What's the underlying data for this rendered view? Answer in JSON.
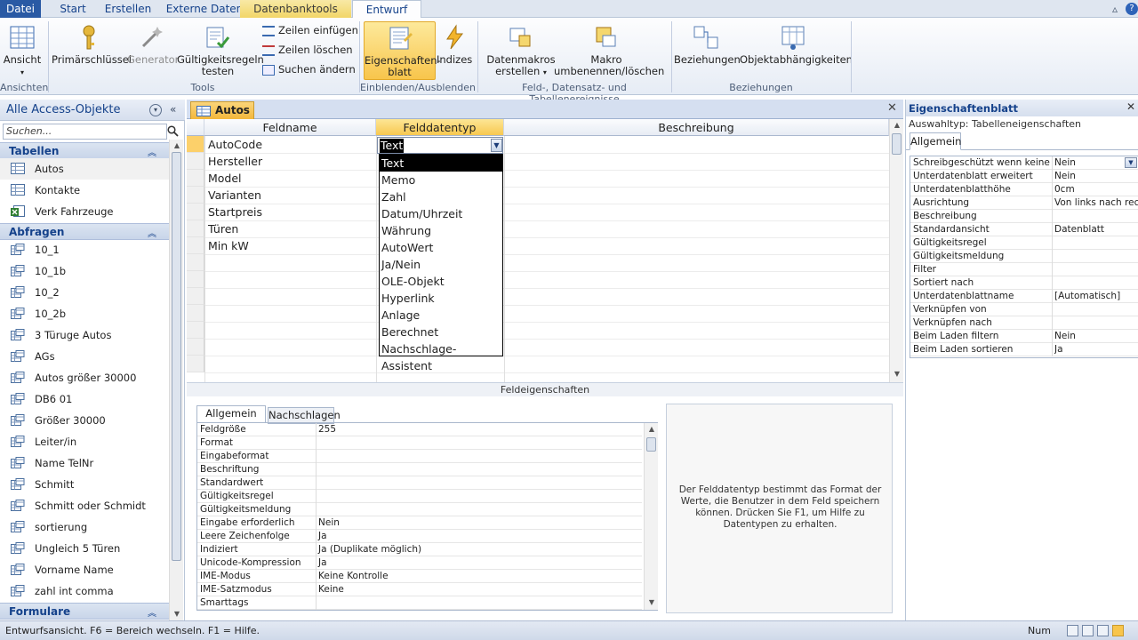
{
  "ribbon_tabs": [
    "Datei",
    "Start",
    "Erstellen",
    "Externe Daten",
    "Datenbanktools",
    "Entwurf"
  ],
  "ribbon": {
    "ansicht": "Ansicht",
    "primaerschluessel": "Primärschlüssel",
    "generator": "Generator",
    "gueltigkeitsregeln": "Gültigkeitsregeln testen",
    "zeilen_einfuegen": "Zeilen einfügen",
    "zeilen_loeschen": "Zeilen löschen",
    "suchen_aendern": "Suchen ändern",
    "eigenschaftenblatt": "Eigenschaften-blatt",
    "indizes": "Indizes",
    "datenmakros": "Datenmakros erstellen",
    "makro": "Makro umbenennen/löschen",
    "beziehungen": "Beziehungen",
    "objektabhaengigkeiten": "Objektabhängigkeiten",
    "groups": {
      "ansichten": "Ansichten",
      "tools": "Tools",
      "einblenden": "Einblenden/Ausblenden",
      "ereignisse": "Feld-, Datensatz- und Tabellenereignisse",
      "beziehungen": "Beziehungen"
    }
  },
  "nav": {
    "title": "Alle Access-Objekte",
    "search_placeholder": "Suchen...",
    "sections": {
      "tabellen": "Tabellen",
      "abfragen": "Abfragen",
      "formulare": "Formulare"
    },
    "tabellen": [
      "Autos",
      "Kontakte",
      "Verk Fahrzeuge"
    ],
    "abfragen": [
      "10_1",
      "10_1b",
      "10_2",
      "10_2b",
      "3 Türuge Autos",
      "AGs",
      "Autos größer 30000",
      "DB6 01",
      "Größer 30000",
      "Leiter/in",
      "Name TelNr",
      "Schmitt",
      "Schmitt oder Schmidt",
      "sortierung",
      "Ungleich 5 Türen",
      "Vorname Name",
      "zahl int comma"
    ]
  },
  "doc": {
    "tab_title": "Autos",
    "columns": [
      "Feldname",
      "Felddatentyp",
      "Beschreibung"
    ],
    "fields": [
      "AutoCode",
      "Hersteller",
      "Model",
      "Varianten",
      "Startpreis",
      "Türen",
      "Min kW"
    ],
    "current_type": "Text",
    "dropdown_options": [
      "Text",
      "Memo",
      "Zahl",
      "Datum/Uhrzeit",
      "Währung",
      "AutoWert",
      "Ja/Nein",
      "OLE-Objekt",
      "Hyperlink",
      "Anlage",
      "Berechnet",
      "Nachschlage-Assistent"
    ],
    "feldeigenschaften": "Feldeigenschaften",
    "prop_tabs": [
      "Allgemein",
      "Nachschlagen"
    ],
    "properties": [
      {
        "k": "Feldgröße",
        "v": "255"
      },
      {
        "k": "Format",
        "v": ""
      },
      {
        "k": "Eingabeformat",
        "v": ""
      },
      {
        "k": "Beschriftung",
        "v": ""
      },
      {
        "k": "Standardwert",
        "v": ""
      },
      {
        "k": "Gültigkeitsregel",
        "v": ""
      },
      {
        "k": "Gültigkeitsmeldung",
        "v": ""
      },
      {
        "k": "Eingabe erforderlich",
        "v": "Nein"
      },
      {
        "k": "Leere Zeichenfolge",
        "v": "Ja"
      },
      {
        "k": "Indiziert",
        "v": "Ja (Duplikate möglich)"
      },
      {
        "k": "Unicode-Kompression",
        "v": "Ja"
      },
      {
        "k": "IME-Modus",
        "v": "Keine Kontrolle"
      },
      {
        "k": "IME-Satzmodus",
        "v": "Keine"
      },
      {
        "k": "Smarttags",
        "v": ""
      }
    ],
    "help_text": "Der Felddatentyp bestimmt das Format der Werte, die Benutzer in dem Feld speichern können. Drücken Sie F1, um Hilfe zu Datentypen zu erhalten."
  },
  "sheet": {
    "title": "Eigenschaftenblatt",
    "auswahltyp": "Auswahltyp:  Tabelleneigenschaften",
    "tab": "Allgemein",
    "rows": [
      {
        "k": "Schreibgeschützt wenn keine Verbindung",
        "v": "Nein"
      },
      {
        "k": "Unterdatenblatt erweitert",
        "v": "Nein"
      },
      {
        "k": "Unterdatenblatthöhe",
        "v": "0cm"
      },
      {
        "k": "Ausrichtung",
        "v": "Von links nach rechts"
      },
      {
        "k": "Beschreibung",
        "v": ""
      },
      {
        "k": "Standardansicht",
        "v": "Datenblatt"
      },
      {
        "k": "Gültigkeitsregel",
        "v": ""
      },
      {
        "k": "Gültigkeitsmeldung",
        "v": ""
      },
      {
        "k": "Filter",
        "v": ""
      },
      {
        "k": "Sortiert nach",
        "v": ""
      },
      {
        "k": "Unterdatenblattname",
        "v": "[Automatisch]"
      },
      {
        "k": "Verknüpfen von",
        "v": ""
      },
      {
        "k": "Verknüpfen nach",
        "v": ""
      },
      {
        "k": "Beim Laden filtern",
        "v": "Nein"
      },
      {
        "k": "Beim Laden sortieren",
        "v": "Ja"
      }
    ]
  },
  "status": {
    "text": "Entwurfsansicht.  F6 = Bereich wechseln.  F1 = Hilfe.",
    "num": "Num"
  },
  "colors": {
    "accent": "#15428b",
    "selected": "#f8c54c",
    "file_tab": "#2a5aa4"
  }
}
